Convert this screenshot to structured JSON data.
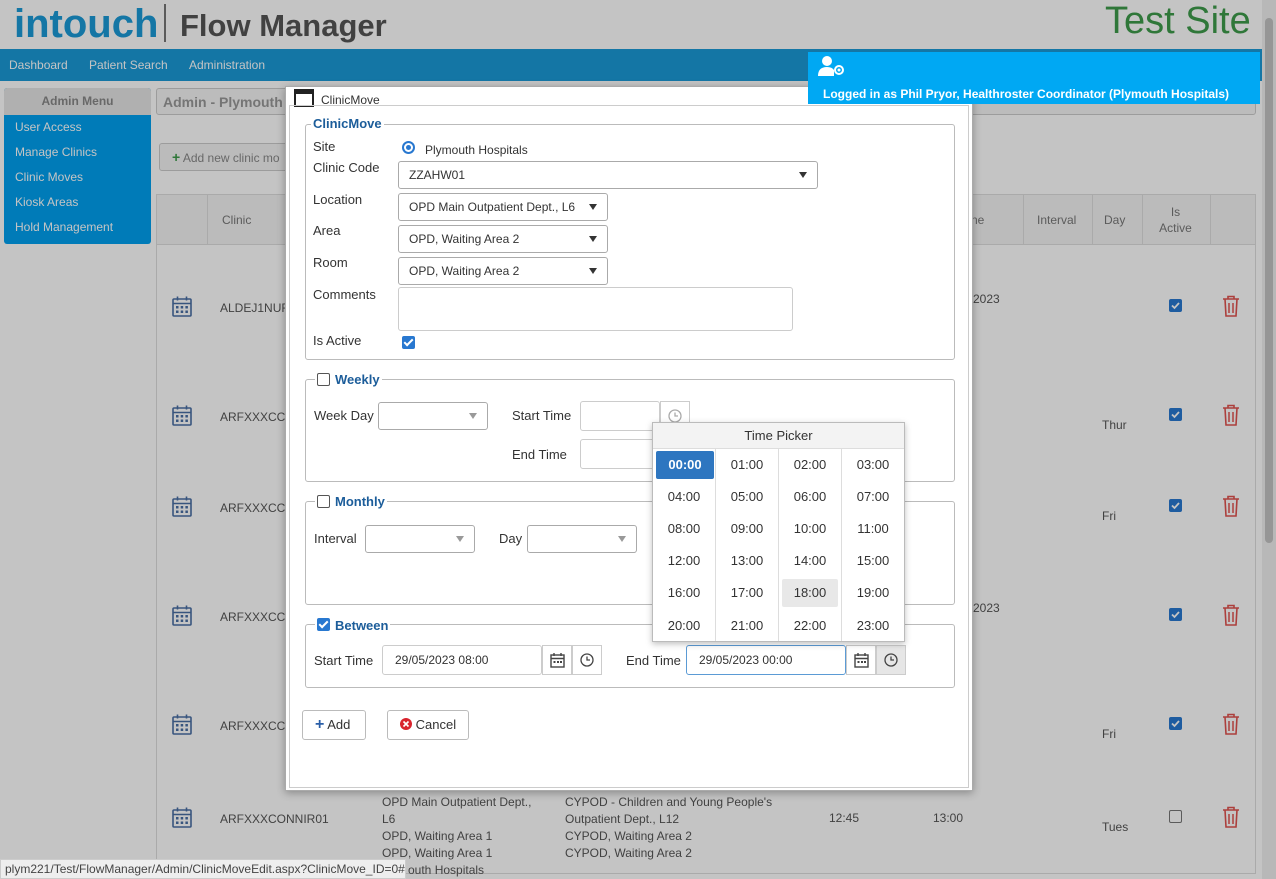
{
  "header": {
    "logo_intouch": "intouch",
    "logo_product": "Flow Manager",
    "site_label": "Test Site"
  },
  "nav": {
    "items": [
      "Dashboard",
      "Patient Search",
      "Administration"
    ]
  },
  "user": {
    "logged_in_text": "Logged in as Phil Pryor, Healthroster Coordinator (Plymouth Hospitals)"
  },
  "admin_menu": {
    "title": "Admin Menu",
    "items": [
      "User Access",
      "Manage Clinics",
      "Clinic Moves",
      "Kiosk Areas",
      "Hold Management"
    ]
  },
  "breadcrumb": {
    "title": "Admin - Plymouth"
  },
  "toolbar": {
    "add_clinic_label": "Add new clinic mo"
  },
  "grid": {
    "columns": {
      "clinic": "Clinic",
      "time_partial": "ne",
      "interval": "Interval",
      "day": "Day",
      "is_active": "Is\nActive"
    },
    "rows": [
      {
        "clinic": "ALDEJ1NUR",
        "extra": "2023",
        "day": "",
        "active": true
      },
      {
        "clinic": "ARFXXXCC",
        "extra": "",
        "day": "Thur",
        "active": true
      },
      {
        "clinic": "ARFXXXCC",
        "extra": "",
        "day": "Fri",
        "active": true
      },
      {
        "clinic": "ARFXXXCC",
        "extra": "2023",
        "day": "",
        "active": true
      },
      {
        "clinic": "ARFXXXCC",
        "extra": "",
        "day": "Fri",
        "active": true
      },
      {
        "clinic": "ARFXXXCONNIR01",
        "extra": "",
        "day": "Tues",
        "active": false
      }
    ],
    "last_row": {
      "from_location": "OPD Main Outpatient Dept., L6",
      "from_area": "OPD, Waiting Area 1",
      "from_room": "OPD, Waiting Area 1",
      "from_site": "outh Hospitals",
      "to_location": "CYPOD - Children and Young People's Outpatient Dept., L12",
      "to_area": "CYPOD, Waiting Area 2",
      "to_room": "CYPOD, Waiting Area 2",
      "start": "12:45",
      "end": "13:00"
    }
  },
  "status_bar": {
    "url": "plym221/Test/FlowManager/Admin/ClinicMoveEdit.aspx?ClinicMove_ID=0#"
  },
  "modal": {
    "title": "ClinicMove",
    "section_title": "ClinicMove",
    "site_label": "Site",
    "site_value": "Plymouth Hospitals",
    "clinic_code_label": "Clinic Code",
    "clinic_code_value": "ZZAHW01",
    "location_label": "Location",
    "location_value": "OPD Main Outpatient Dept., L6",
    "area_label": "Area",
    "area_value": "OPD, Waiting Area 2",
    "room_label": "Room",
    "room_value": "OPD, Waiting Area 2",
    "comments_label": "Comments",
    "comments_value": "",
    "is_active_label": "Is Active",
    "is_active": true,
    "weekly": {
      "title": "Weekly",
      "checked": false,
      "week_day_label": "Week Day",
      "week_day_value": "",
      "start_time_label": "Start Time",
      "start_time_value": "",
      "end_time_label": "End Time",
      "end_time_value": ""
    },
    "monthly": {
      "title": "Monthly",
      "checked": false,
      "interval_label": "Interval",
      "interval_value": "",
      "day_label": "Day",
      "day_value": ""
    },
    "between": {
      "title": "Between",
      "checked": true,
      "start_time_label": "Start Time",
      "start_time_value": "29/05/2023 08:00",
      "end_time_label": "End Time",
      "end_time_value": "29/05/2023 00:00"
    },
    "add_button": "Add",
    "cancel_button": "Cancel"
  },
  "time_picker": {
    "title": "Time Picker",
    "times": [
      "00:00",
      "01:00",
      "02:00",
      "03:00",
      "04:00",
      "05:00",
      "06:00",
      "07:00",
      "08:00",
      "09:00",
      "10:00",
      "11:00",
      "12:00",
      "13:00",
      "14:00",
      "15:00",
      "16:00",
      "17:00",
      "18:00",
      "19:00",
      "20:00",
      "21:00",
      "22:00",
      "23:00"
    ],
    "selected": "00:00",
    "hovered": "18:00"
  },
  "colors": {
    "brand_blue": "#1a9ad7",
    "test_site_green": "#3e9b4b",
    "menu_blue": "#00a0f0",
    "legend_blue": "#1c5d9a",
    "delete_red": "#d9534f"
  }
}
